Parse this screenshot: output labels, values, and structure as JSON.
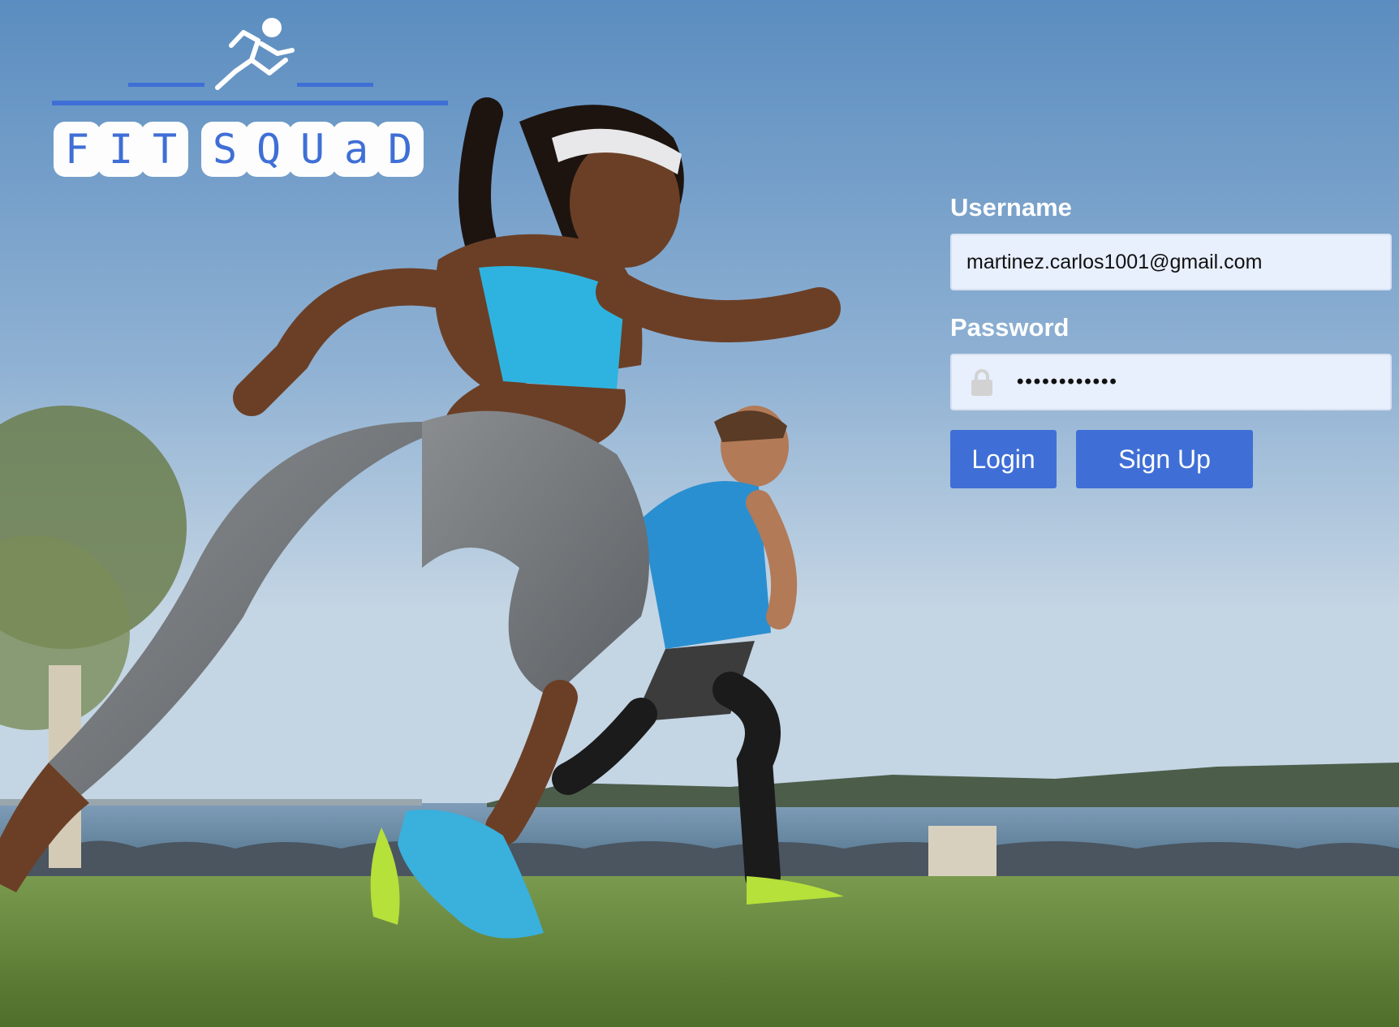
{
  "brand": {
    "letters_first": [
      "F",
      "I",
      "T"
    ],
    "letters_second": [
      "S",
      "Q",
      "U",
      "a",
      "D"
    ],
    "logo_icon": "running-person-icon",
    "accent_color": "#3f6fd6"
  },
  "background": {
    "description_icon": "runners-photo"
  },
  "login_form": {
    "username_label": "Username",
    "username_value": "martinez.carlos1001@gmail.com",
    "password_label": "Password",
    "password_value": "••••••••••••",
    "password_icon": "lock-icon",
    "login_button": "Login",
    "signup_button": "Sign Up",
    "button_color": "#3f6fd6",
    "input_background": "#e8effd"
  }
}
